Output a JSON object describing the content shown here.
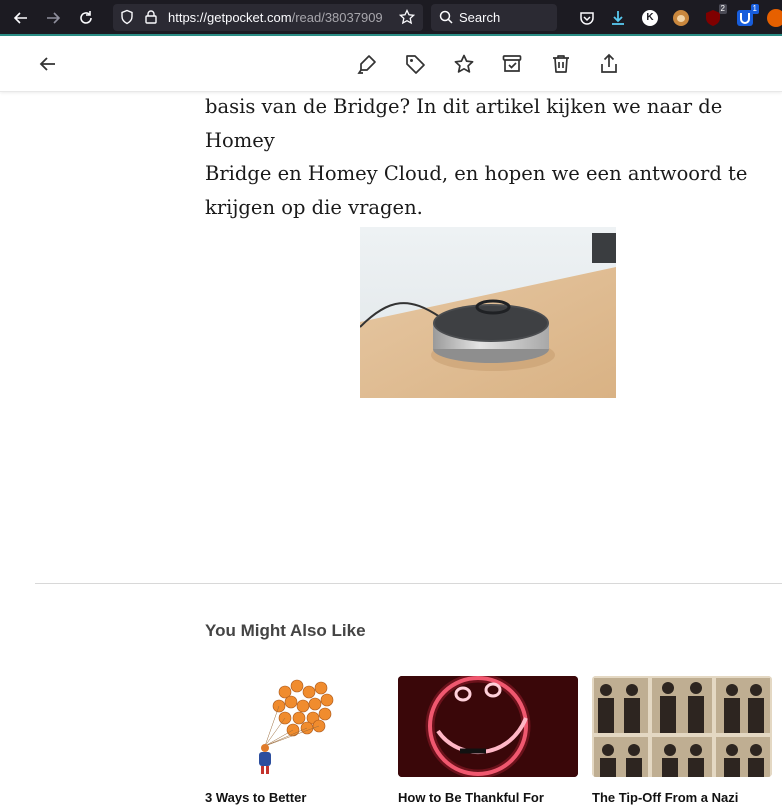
{
  "browser": {
    "url_host": "https://getpocket.com",
    "url_path": "/read/38037909",
    "search_placeholder": "Search",
    "ext_k_label": "K",
    "ext_badge_1": "2",
    "ext_badge_2": "1"
  },
  "article": {
    "lines": [
      "basis van de Bridge? In dit artikel kijken we naar de Homey",
      "Bridge en Homey Cloud, en hopen we een antwoord te",
      "krijgen op die vragen."
    ]
  },
  "recommendations": {
    "heading": "You Might Also Like",
    "cards": [
      {
        "title": "3 Ways to Better"
      },
      {
        "title": "How to Be Thankful For"
      },
      {
        "title": "The Tip-Off From a Nazi"
      }
    ]
  }
}
